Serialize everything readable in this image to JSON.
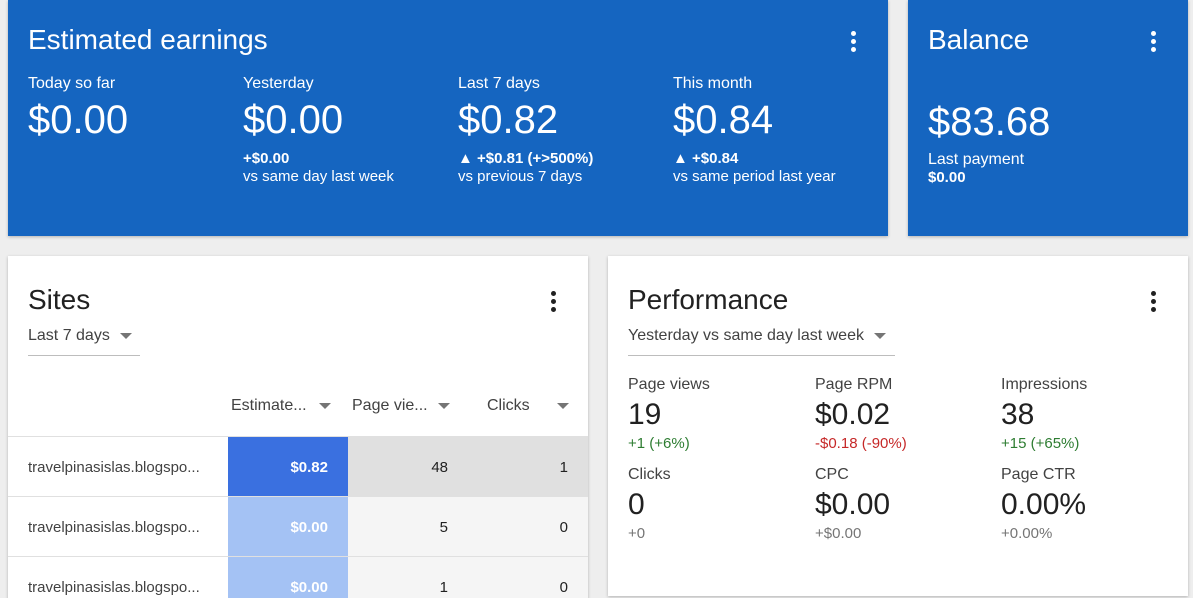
{
  "earnings": {
    "title": "Estimated earnings",
    "columns": [
      {
        "label": "Today so far",
        "value": "$0.00",
        "delta": "",
        "sub": ""
      },
      {
        "label": "Yesterday",
        "value": "$0.00",
        "delta": "+$0.00",
        "sub": "vs same day last week"
      },
      {
        "label": "Last 7 days",
        "value": "$0.82",
        "delta": "▲ +$0.81 (+>500%)",
        "sub": "vs previous 7 days"
      },
      {
        "label": "This month",
        "value": "$0.84",
        "delta": "▲ +$0.84",
        "sub": "vs same period last year"
      }
    ]
  },
  "balance": {
    "title": "Balance",
    "value": "$83.68",
    "last_payment_label": "Last payment",
    "last_payment_value": "$0.00"
  },
  "sites": {
    "title": "Sites",
    "range": "Last 7 days",
    "headers": [
      "Estimate...",
      "Page vie...",
      "Clicks"
    ],
    "rows": [
      {
        "site": "travelpinasislas.blogspo...",
        "earnings": "$0.82",
        "page_views": "48",
        "clicks": "1"
      },
      {
        "site": "travelpinasislas.blogspo...",
        "earnings": "$0.00",
        "page_views": "5",
        "clicks": "0"
      },
      {
        "site": "travelpinasislas.blogspo...",
        "earnings": "$0.00",
        "page_views": "1",
        "clicks": "0"
      }
    ]
  },
  "performance": {
    "title": "Performance",
    "range": "Yesterday vs same day last week",
    "metrics": [
      {
        "label": "Page views",
        "value": "19",
        "delta": "+1 (+6%)"
      },
      {
        "label": "Page RPM",
        "value": "$0.02",
        "delta": "-$0.18 (-90%)"
      },
      {
        "label": "Impressions",
        "value": "38",
        "delta": "+15 (+65%)"
      },
      {
        "label": "Clicks",
        "value": "0",
        "delta": "+0"
      },
      {
        "label": "CPC",
        "value": "$0.00",
        "delta": "+$0.00"
      },
      {
        "label": "Page CTR",
        "value": "0.00%",
        "delta": "+0.00%"
      }
    ]
  },
  "colors": {
    "card_blue": "#1565c0",
    "cell_strong_blue": "#3a70e0",
    "cell_light_blue": "#a4c2f4",
    "positive": "#2e7d32",
    "negative": "#c62828"
  }
}
